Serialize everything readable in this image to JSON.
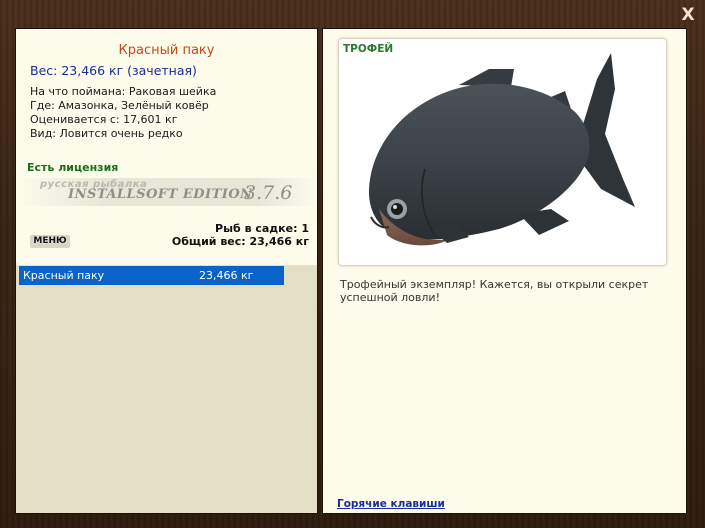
{
  "window": {
    "close_label": "X"
  },
  "fish": {
    "name": "Красный паку",
    "weight_line": "Вес: 23,466 кг (зачетная)",
    "bait_line": "На что поймана: Раковая шейка",
    "place_line": "Где: Амазонка, Зелёный ковёр",
    "price_line": "Оценивается с: 17,601 кг",
    "kind_line": "Вид: Ловится очень редко"
  },
  "license": "Есть лицензия",
  "watermark": {
    "top": "русская рыбалка",
    "main": "INSTALLSOFT EDITION",
    "version": "3.7.6"
  },
  "net": {
    "count_line": "Рыб в садке: 1",
    "total_line": "Общий вес: 23,466 кг"
  },
  "menu_label": "МЕНЮ",
  "catch_list": [
    {
      "name": "Красный паку",
      "weight": "23,466 кг"
    }
  ],
  "trophy": {
    "label": "ТРОФЕЙ",
    "description": "Трофейный экземпляр! Кажется, вы открыли секрет успешной ловли!"
  },
  "hotkeys_label": "Горячие клавиши",
  "colors": {
    "fish_name": "#c8461a",
    "weight": "#1a2d9c",
    "license": "#1d6f1d",
    "selection": "#0a63c9"
  }
}
